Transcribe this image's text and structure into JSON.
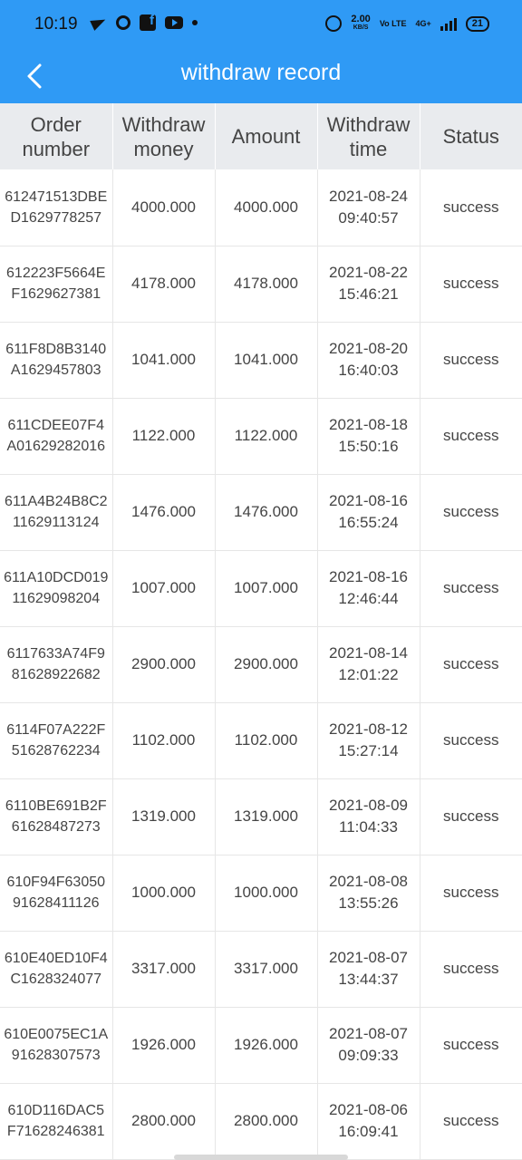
{
  "status_bar": {
    "time": "10:19",
    "speed_value": "2.00",
    "speed_unit": "KB/S",
    "network_volte": "Vo LTE",
    "network_type": "4G+",
    "battery": "21"
  },
  "header": {
    "title": "withdraw record",
    "back_icon": "chevron-left-icon",
    "background": "#2f9af5"
  },
  "table": {
    "columns": [
      "Order number",
      "Withdraw money",
      "Amount",
      "Withdraw time",
      "Status"
    ],
    "rows": [
      {
        "order": "612471513DBED1629778257",
        "money": "4000.000",
        "amount": "4000.000",
        "date": "2021-08-24",
        "time": "09:40:57",
        "status": "success"
      },
      {
        "order": "612223F5664EF1629627381",
        "money": "4178.000",
        "amount": "4178.000",
        "date": "2021-08-22",
        "time": "15:46:21",
        "status": "success"
      },
      {
        "order": "611F8D8B3140A1629457803",
        "money": "1041.000",
        "amount": "1041.000",
        "date": "2021-08-20",
        "time": "16:40:03",
        "status": "success"
      },
      {
        "order": "611CDEE07F4A01629282016",
        "money": "1122.000",
        "amount": "1122.000",
        "date": "2021-08-18",
        "time": "15:50:16",
        "status": "success"
      },
      {
        "order": "611A4B24B8C211629113124",
        "money": "1476.000",
        "amount": "1476.000",
        "date": "2021-08-16",
        "time": "16:55:24",
        "status": "success"
      },
      {
        "order": "611A10DCD01911629098204",
        "money": "1007.000",
        "amount": "1007.000",
        "date": "2021-08-16",
        "time": "12:46:44",
        "status": "success"
      },
      {
        "order": "6117633A74F981628922682",
        "money": "2900.000",
        "amount": "2900.000",
        "date": "2021-08-14",
        "time": "12:01:22",
        "status": "success"
      },
      {
        "order": "6114F07A222F51628762234",
        "money": "1102.000",
        "amount": "1102.000",
        "date": "2021-08-12",
        "time": "15:27:14",
        "status": "success"
      },
      {
        "order": "6110BE691B2F61628487273",
        "money": "1319.000",
        "amount": "1319.000",
        "date": "2021-08-09",
        "time": "11:04:33",
        "status": "success"
      },
      {
        "order": "610F94F6305091628411126",
        "money": "1000.000",
        "amount": "1000.000",
        "date": "2021-08-08",
        "time": "13:55:26",
        "status": "success"
      },
      {
        "order": "610E40ED10F4C1628324077",
        "money": "3317.000",
        "amount": "3317.000",
        "date": "2021-08-07",
        "time": "13:44:37",
        "status": "success"
      },
      {
        "order": "610E0075EC1A91628307573",
        "money": "1926.000",
        "amount": "1926.000",
        "date": "2021-08-07",
        "time": "09:09:33",
        "status": "success"
      },
      {
        "order": "610D116DAC5F71628246381",
        "money": "2800.000",
        "amount": "2800.000",
        "date": "2021-08-06",
        "time": "16:09:41",
        "status": "success"
      }
    ]
  }
}
